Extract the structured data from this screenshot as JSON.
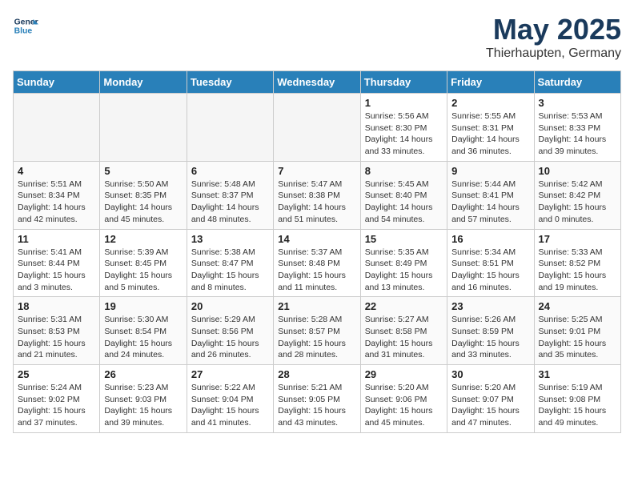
{
  "header": {
    "logo_line1": "General",
    "logo_line2": "Blue",
    "month": "May 2025",
    "location": "Thierhaupten, Germany"
  },
  "days_of_week": [
    "Sunday",
    "Monday",
    "Tuesday",
    "Wednesday",
    "Thursday",
    "Friday",
    "Saturday"
  ],
  "weeks": [
    [
      {
        "day": "",
        "info": ""
      },
      {
        "day": "",
        "info": ""
      },
      {
        "day": "",
        "info": ""
      },
      {
        "day": "",
        "info": ""
      },
      {
        "day": "1",
        "info": "Sunrise: 5:56 AM\nSunset: 8:30 PM\nDaylight: 14 hours\nand 33 minutes."
      },
      {
        "day": "2",
        "info": "Sunrise: 5:55 AM\nSunset: 8:31 PM\nDaylight: 14 hours\nand 36 minutes."
      },
      {
        "day": "3",
        "info": "Sunrise: 5:53 AM\nSunset: 8:33 PM\nDaylight: 14 hours\nand 39 minutes."
      }
    ],
    [
      {
        "day": "4",
        "info": "Sunrise: 5:51 AM\nSunset: 8:34 PM\nDaylight: 14 hours\nand 42 minutes."
      },
      {
        "day": "5",
        "info": "Sunrise: 5:50 AM\nSunset: 8:35 PM\nDaylight: 14 hours\nand 45 minutes."
      },
      {
        "day": "6",
        "info": "Sunrise: 5:48 AM\nSunset: 8:37 PM\nDaylight: 14 hours\nand 48 minutes."
      },
      {
        "day": "7",
        "info": "Sunrise: 5:47 AM\nSunset: 8:38 PM\nDaylight: 14 hours\nand 51 minutes."
      },
      {
        "day": "8",
        "info": "Sunrise: 5:45 AM\nSunset: 8:40 PM\nDaylight: 14 hours\nand 54 minutes."
      },
      {
        "day": "9",
        "info": "Sunrise: 5:44 AM\nSunset: 8:41 PM\nDaylight: 14 hours\nand 57 minutes."
      },
      {
        "day": "10",
        "info": "Sunrise: 5:42 AM\nSunset: 8:42 PM\nDaylight: 15 hours\nand 0 minutes."
      }
    ],
    [
      {
        "day": "11",
        "info": "Sunrise: 5:41 AM\nSunset: 8:44 PM\nDaylight: 15 hours\nand 3 minutes."
      },
      {
        "day": "12",
        "info": "Sunrise: 5:39 AM\nSunset: 8:45 PM\nDaylight: 15 hours\nand 5 minutes."
      },
      {
        "day": "13",
        "info": "Sunrise: 5:38 AM\nSunset: 8:47 PM\nDaylight: 15 hours\nand 8 minutes."
      },
      {
        "day": "14",
        "info": "Sunrise: 5:37 AM\nSunset: 8:48 PM\nDaylight: 15 hours\nand 11 minutes."
      },
      {
        "day": "15",
        "info": "Sunrise: 5:35 AM\nSunset: 8:49 PM\nDaylight: 15 hours\nand 13 minutes."
      },
      {
        "day": "16",
        "info": "Sunrise: 5:34 AM\nSunset: 8:51 PM\nDaylight: 15 hours\nand 16 minutes."
      },
      {
        "day": "17",
        "info": "Sunrise: 5:33 AM\nSunset: 8:52 PM\nDaylight: 15 hours\nand 19 minutes."
      }
    ],
    [
      {
        "day": "18",
        "info": "Sunrise: 5:31 AM\nSunset: 8:53 PM\nDaylight: 15 hours\nand 21 minutes."
      },
      {
        "day": "19",
        "info": "Sunrise: 5:30 AM\nSunset: 8:54 PM\nDaylight: 15 hours\nand 24 minutes."
      },
      {
        "day": "20",
        "info": "Sunrise: 5:29 AM\nSunset: 8:56 PM\nDaylight: 15 hours\nand 26 minutes."
      },
      {
        "day": "21",
        "info": "Sunrise: 5:28 AM\nSunset: 8:57 PM\nDaylight: 15 hours\nand 28 minutes."
      },
      {
        "day": "22",
        "info": "Sunrise: 5:27 AM\nSunset: 8:58 PM\nDaylight: 15 hours\nand 31 minutes."
      },
      {
        "day": "23",
        "info": "Sunrise: 5:26 AM\nSunset: 8:59 PM\nDaylight: 15 hours\nand 33 minutes."
      },
      {
        "day": "24",
        "info": "Sunrise: 5:25 AM\nSunset: 9:01 PM\nDaylight: 15 hours\nand 35 minutes."
      }
    ],
    [
      {
        "day": "25",
        "info": "Sunrise: 5:24 AM\nSunset: 9:02 PM\nDaylight: 15 hours\nand 37 minutes."
      },
      {
        "day": "26",
        "info": "Sunrise: 5:23 AM\nSunset: 9:03 PM\nDaylight: 15 hours\nand 39 minutes."
      },
      {
        "day": "27",
        "info": "Sunrise: 5:22 AM\nSunset: 9:04 PM\nDaylight: 15 hours\nand 41 minutes."
      },
      {
        "day": "28",
        "info": "Sunrise: 5:21 AM\nSunset: 9:05 PM\nDaylight: 15 hours\nand 43 minutes."
      },
      {
        "day": "29",
        "info": "Sunrise: 5:20 AM\nSunset: 9:06 PM\nDaylight: 15 hours\nand 45 minutes."
      },
      {
        "day": "30",
        "info": "Sunrise: 5:20 AM\nSunset: 9:07 PM\nDaylight: 15 hours\nand 47 minutes."
      },
      {
        "day": "31",
        "info": "Sunrise: 5:19 AM\nSunset: 9:08 PM\nDaylight: 15 hours\nand 49 minutes."
      }
    ]
  ]
}
